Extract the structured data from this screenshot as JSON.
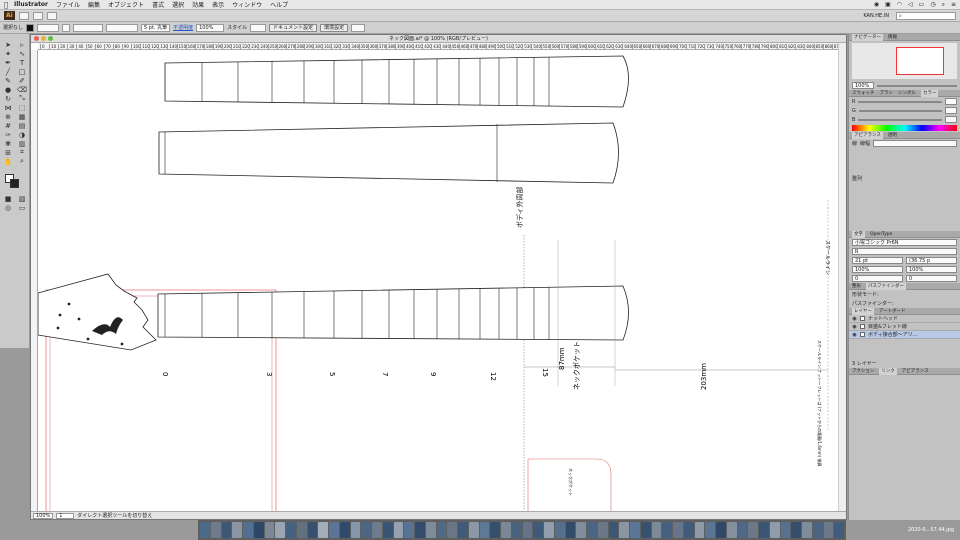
{
  "menubar": {
    "app": "Illustrator",
    "items": [
      "ファイル",
      "編集",
      "オブジェクト",
      "書式",
      "選択",
      "効果",
      "表示",
      "ウィンドウ",
      "ヘルプ"
    ],
    "right_icons": [
      "ai-icon",
      "box-icon",
      "wifi-icon",
      "volume-icon",
      "battery-icon",
      "clock-icon",
      "search-icon",
      "list-icon"
    ]
  },
  "appbar": {
    "logo": "Ai",
    "user": "KAN.HE.IN"
  },
  "control": {
    "label": "選択なし",
    "stroke_size": "5 pt. 丸筆",
    "opacity_label": "不透明度",
    "opacity_value": "100%",
    "style_label": "スタイル",
    "doc_setup_btn": "ドキュメント設定",
    "prefs_btn": "環境設定"
  },
  "document": {
    "title": "ネック図面.ai* @ 100% (RGB/プレビュー)",
    "ruler_ticks": [
      "0",
      "10",
      "20",
      "30",
      "40",
      "50",
      "60",
      "70",
      "80",
      "90",
      "100",
      "110",
      "120",
      "130",
      "140",
      "150",
      "160",
      "170",
      "180",
      "190",
      "200",
      "210",
      "220",
      "230",
      "240",
      "250",
      "260",
      "270",
      "280",
      "290",
      "300",
      "310",
      "320",
      "330",
      "340",
      "350",
      "360",
      "370",
      "380",
      "390",
      "400",
      "410",
      "420",
      "430",
      "440",
      "450",
      "460",
      "470",
      "480",
      "490",
      "500",
      "510",
      "520",
      "530",
      "540",
      "550",
      "560",
      "570",
      "580",
      "590",
      "600",
      "610",
      "620",
      "630",
      "640",
      "650",
      "660",
      "670",
      "680",
      "690",
      "700",
      "710",
      "720",
      "730",
      "740",
      "750",
      "760",
      "770",
      "780",
      "790",
      "800",
      "810",
      "820",
      "830",
      "840",
      "850",
      "860",
      "870"
    ],
    "status": {
      "zoom": "100%",
      "page": "1",
      "tool_hint": "ダイレクト選択ツールを切り替え"
    }
  },
  "drawing": {
    "fret_labels": [
      "0",
      "3",
      "5",
      "7",
      "9",
      "12",
      "15"
    ],
    "body_perimeter_label": "ボディ外周部",
    "neck_pocket_label": "ネックポケット",
    "dim_87": "87mm",
    "dim_203": "203mm",
    "scale_line_label": "スケールライン",
    "scale_note": "スケールライン:ナット〜フレットは\n(ナットからの距離/1.6mm) 換算",
    "pocket_small_label": "ネックポケット"
  },
  "panels": {
    "nav_tabs": [
      "ナビゲーター",
      "情報"
    ],
    "nav_zoom": "100%",
    "color_tabs": [
      "スウォッチ",
      "ブラシ",
      "シンボル",
      "カラー"
    ],
    "color_labels": [
      "R",
      "G",
      "B"
    ],
    "appearance_tabs": [
      "アピアランス",
      "透明"
    ],
    "appearance_title": "線",
    "stroke_field": "線幅",
    "align_title": "整列",
    "char_tabs": [
      "文字",
      "OpenType"
    ],
    "font_name": "小塚ゴシック Pr6N",
    "font_style": "R",
    "font_size": "21 pt",
    "leading": "(36.75 p",
    "tracking": "100%",
    "kerning": "0",
    "size2": "100%",
    "zero2": "0",
    "pathfinder_tabs": [
      "整形",
      "パスファインダー"
    ],
    "shape_mode": "形状モード:",
    "pathfinder": "パスファインダー:",
    "layer_tabs": [
      "レイヤー",
      "アートボード"
    ],
    "layers": [
      "ナットヘッド",
      "目盛&フレット線",
      "ボディ接合部〜アリ..."
    ],
    "layer_count": "3 レイヤー",
    "bottom_tabs": [
      "アクション",
      "リンク",
      "アピアランス"
    ]
  },
  "dock": {
    "filename": "2020-0...57.44.jpg"
  },
  "colors": {
    "dock_palette": [
      "#4a6b8a",
      "#6f7a8c",
      "#3d5775",
      "#8b94a3",
      "#526f92",
      "#2e4766",
      "#7b8796",
      "#9aa4b2",
      "#456281",
      "#637080",
      "#38506e",
      "#a3aebb",
      "#5a7595",
      "#2f4a6a",
      "#8596a8",
      "#4d6684",
      "#6e7b8c",
      "#3a5473",
      "#95a1af",
      "#587393",
      "#334c6a",
      "#7e8b9b",
      "#4f6988",
      "#6a7686",
      "#405b7a",
      "#8d98a6",
      "#5e7898",
      "#354f6d",
      "#7a8797",
      "#49637f",
      "#66738a",
      "#3f5a78",
      "#929eac",
      "#55708f",
      "#324b68",
      "#818e9e",
      "#4b6584",
      "#6b7787",
      "#3c5675",
      "#8a95a4",
      "#5b7696",
      "#37516f",
      "#7c8999",
      "#466180",
      "#687489",
      "#415c7b",
      "#8f9ba9",
      "#5a7494",
      "#304968",
      "#848fa0",
      "#4e6886",
      "#6c7888",
      "#3b5574",
      "#909caa",
      "#567191",
      "#344e6c",
      "#7f8c9c",
      "#4a6482",
      "#6d7989",
      "#425d7c"
    ]
  }
}
